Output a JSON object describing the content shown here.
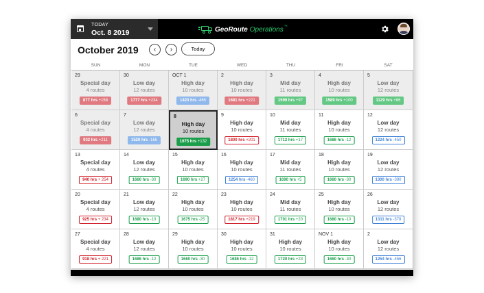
{
  "header": {
    "today_label": "TODAY",
    "today_date": "Oct. 8 2019",
    "logo_primary": "GeoRoute",
    "logo_secondary": "Operations",
    "logo_tm": "™",
    "accent_color": "#2ecc71"
  },
  "calendar": {
    "month_title": "October 2019",
    "prev_label": "‹",
    "next_label": "›",
    "today_button": "Today",
    "weekdays": [
      "SUN",
      "MON",
      "TUE",
      "WED",
      "THU",
      "FRI",
      "SAT"
    ],
    "weeks": [
      [
        {
          "day": "29",
          "type": "Special day",
          "routes": "4 routes",
          "hrs": "877 hrs",
          "delta": "+158",
          "badge": "red-f",
          "muted": true
        },
        {
          "day": "30",
          "type": "Low day",
          "routes": "12 routes",
          "hrs": "1777 hrs",
          "delta": "+234",
          "badge": "red-f",
          "muted": true
        },
        {
          "day": "OCT 1",
          "type": "High day",
          "routes": "10 routes",
          "hrs": "1420 hrs",
          "delta": "-465",
          "badge": "blue-f",
          "muted": true
        },
        {
          "day": "2",
          "type": "High day",
          "routes": "10 routes",
          "hrs": "1681 hrs",
          "delta": "+221",
          "badge": "red-f",
          "muted": true
        },
        {
          "day": "3",
          "type": "Mid day",
          "routes": "11 routes",
          "hrs": "1599 hrs",
          "delta": "+97",
          "badge": "green-f",
          "muted": true
        },
        {
          "day": "4",
          "type": "High day",
          "routes": "10 routes",
          "hrs": "1589 hrs",
          "delta": "+100",
          "badge": "green-f",
          "muted": true
        },
        {
          "day": "5",
          "type": "Low day",
          "routes": "12 routes",
          "hrs": "1129 hrs",
          "delta": "+86",
          "badge": "green-f",
          "muted": true
        }
      ],
      [
        {
          "day": "6",
          "type": "Special day",
          "routes": "4 routes",
          "hrs": "932 hrs",
          "delta": "+211",
          "badge": "red-f",
          "muted": true
        },
        {
          "day": "7",
          "type": "Low day",
          "routes": "12 routes",
          "hrs": "1520 hrs",
          "delta": "-165",
          "badge": "blue-f",
          "muted": true
        },
        {
          "day": "8",
          "type": "High day",
          "routes": "10 routes",
          "hrs": "1675 hrs",
          "delta": "+132",
          "badge": "green-s",
          "selected": true
        },
        {
          "day": "9",
          "type": "High day",
          "routes": "10 routes",
          "hrs": "1800 hrs",
          "delta": "+201",
          "badge": "red-o"
        },
        {
          "day": "10",
          "type": "Mid day",
          "routes": "11 routes",
          "hrs": "1712 hrs",
          "delta": "+17",
          "badge": "green-o"
        },
        {
          "day": "11",
          "type": "High day",
          "routes": "10 routes",
          "hrs": "1686 hrs",
          "delta": "-12",
          "badge": "green-o"
        },
        {
          "day": "12",
          "type": "Low day",
          "routes": "12 routes",
          "hrs": "1224 hrs",
          "delta": "-450",
          "badge": "blue-o"
        }
      ],
      [
        {
          "day": "13",
          "type": "Special day",
          "routes": "4 routes",
          "hrs": "940 hrs",
          "delta": "+ 254",
          "badge": "red-o"
        },
        {
          "day": "14",
          "type": "Low day",
          "routes": "12 routes",
          "hrs": "1660 hrs",
          "delta": "-30",
          "badge": "green-o"
        },
        {
          "day": "15",
          "type": "High day",
          "routes": "10 routes",
          "hrs": "1690 hrs",
          "delta": "+27",
          "badge": "green-o"
        },
        {
          "day": "16",
          "type": "High day",
          "routes": "10 routes",
          "hrs": "1254 hrs",
          "delta": "-460",
          "badge": "blue-o"
        },
        {
          "day": "17",
          "type": "Mid day",
          "routes": "11 routes",
          "hrs": "1690 hrs",
          "delta": "+5",
          "badge": "green-o"
        },
        {
          "day": "18",
          "type": "High day",
          "routes": "10 routes",
          "hrs": "1660 hrs",
          "delta": "-30",
          "badge": "green-o"
        },
        {
          "day": "19",
          "type": "Low day",
          "routes": "12 routes",
          "hrs": "1300 hrs",
          "delta": "-390",
          "badge": "blue-o"
        }
      ],
      [
        {
          "day": "20",
          "type": "Special day",
          "routes": "4 routes",
          "hrs": "925 hrs",
          "delta": "+ 234",
          "badge": "red-o"
        },
        {
          "day": "21",
          "type": "Low day",
          "routes": "12 routes",
          "hrs": "1680 hrs",
          "delta": "-10",
          "badge": "green-o"
        },
        {
          "day": "22",
          "type": "High day",
          "routes": "10 routes",
          "hrs": "1675 hrs",
          "delta": "-25",
          "badge": "green-o"
        },
        {
          "day": "23",
          "type": "High day",
          "routes": "10 routes",
          "hrs": "1817 hrs",
          "delta": "+219",
          "badge": "red-o"
        },
        {
          "day": "24",
          "type": "Mid day",
          "routes": "11 routes",
          "hrs": "1701 hrs",
          "delta": "+20",
          "badge": "green-o"
        },
        {
          "day": "25",
          "type": "High day",
          "routes": "10 routes",
          "hrs": "1680 hrs",
          "delta": "-10",
          "badge": "green-o"
        },
        {
          "day": "26",
          "type": "Low day",
          "routes": "12 routes",
          "hrs": "1311 hrs",
          "delta": "-378",
          "badge": "blue-o"
        }
      ],
      [
        {
          "day": "27",
          "type": "Special day",
          "routes": "4 routes",
          "hrs": "918 hrs",
          "delta": "+ 221",
          "badge": "red-o"
        },
        {
          "day": "28",
          "type": "Low day",
          "routes": "12 routes",
          "hrs": "1686 hrs",
          "delta": "-12",
          "badge": "green-o"
        },
        {
          "day": "29",
          "type": "High day",
          "routes": "10 routes",
          "hrs": "1660 hrs",
          "delta": "-30",
          "badge": "green-o"
        },
        {
          "day": "30",
          "type": "High day",
          "routes": "10 routes",
          "hrs": "1686 hrs",
          "delta": "-12",
          "badge": "green-o"
        },
        {
          "day": "31",
          "type": "High day",
          "routes": "10 routes",
          "hrs": "1720 hrs",
          "delta": "+23",
          "badge": "green-o"
        },
        {
          "day": "NOV 1",
          "type": "High day",
          "routes": "10 routes",
          "hrs": "1660 hrs",
          "delta": "-30",
          "badge": "green-o"
        },
        {
          "day": "2",
          "type": "Low day",
          "routes": "12 routes",
          "hrs": "1254 hrs",
          "delta": "-456",
          "badge": "blue-o"
        }
      ]
    ]
  }
}
